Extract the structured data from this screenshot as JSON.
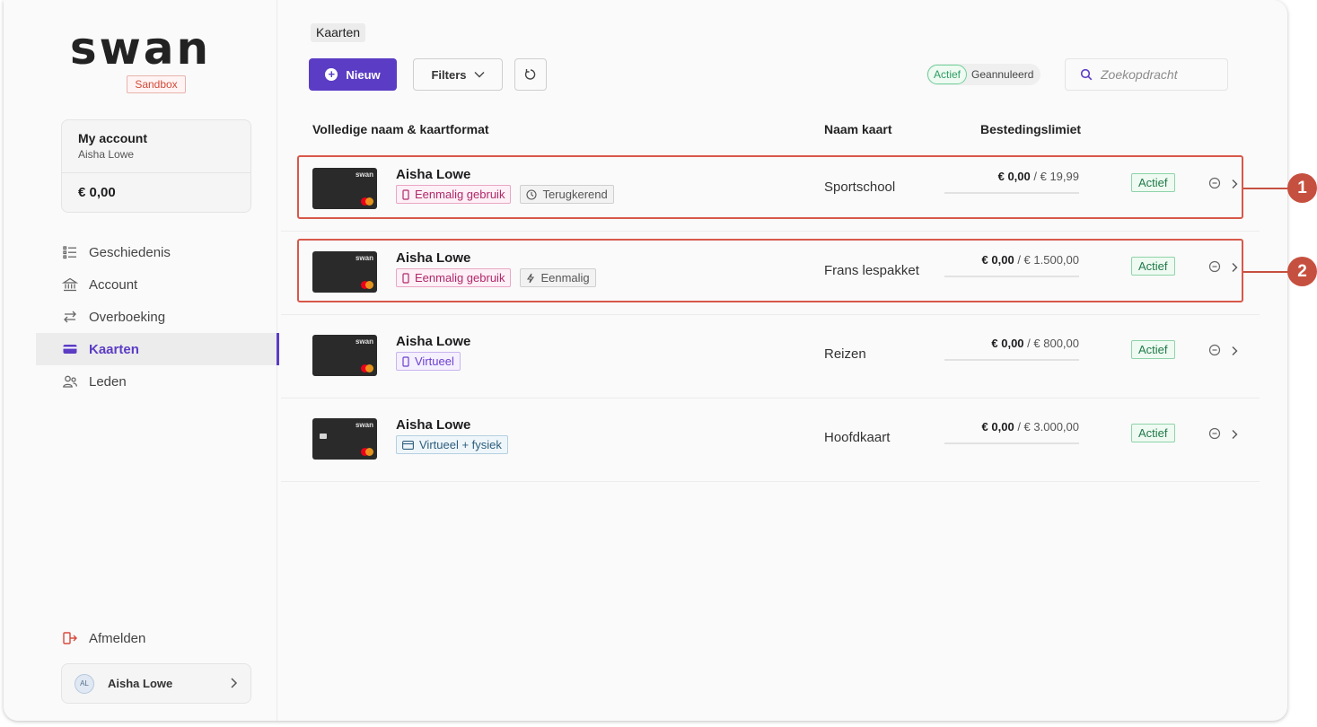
{
  "brand": {
    "logo": "swan",
    "env": "Sandbox"
  },
  "account": {
    "title": "My account",
    "holder": "Aisha Lowe",
    "balance": "€ 0,00"
  },
  "nav": [
    {
      "label": "Geschiedenis",
      "icon": "list-icon"
    },
    {
      "label": "Account",
      "icon": "bank-icon"
    },
    {
      "label": "Overboeking",
      "icon": "transfer-icon"
    },
    {
      "label": "Kaarten",
      "icon": "card-icon",
      "active": true
    },
    {
      "label": "Leden",
      "icon": "members-icon"
    }
  ],
  "logout": "Afmelden",
  "user": {
    "initials": "AL",
    "name": "Aisha Lowe"
  },
  "breadcrumb": "Kaarten",
  "toolbar": {
    "new_label": "Nieuw",
    "filters_label": "Filters"
  },
  "status_filter": {
    "active": "Actief",
    "cancelled": "Geannuleerd"
  },
  "search": {
    "placeholder": "Zoekopdracht"
  },
  "columns": {
    "name_format": "Volledige naam & kaartformat",
    "card_name": "Naam kaart",
    "limit": "Bestedingslimiet"
  },
  "rows": [
    {
      "holder": "Aisha Lowe",
      "tags": [
        {
          "label": "Eenmalig gebruik",
          "style": "pink",
          "icon": "phone-icon"
        },
        {
          "label": "Terugkerend",
          "style": "gray",
          "icon": "clock-icon"
        }
      ],
      "card_name": "Sportschool",
      "spent": "€ 0,00",
      "limit": "/ € 19,99",
      "status": "Actief"
    },
    {
      "holder": "Aisha Lowe",
      "tags": [
        {
          "label": "Eenmalig gebruik",
          "style": "pink",
          "icon": "phone-icon"
        },
        {
          "label": "Eenmalig",
          "style": "gray",
          "icon": "bolt-icon"
        }
      ],
      "card_name": "Frans lespakket",
      "spent": "€ 0,00",
      "limit": "/ € 1.500,00",
      "status": "Actief"
    },
    {
      "holder": "Aisha Lowe",
      "tags": [
        {
          "label": "Virtueel",
          "style": "purple",
          "icon": "phone-icon"
        }
      ],
      "card_name": "Reizen",
      "spent": "€ 0,00",
      "limit": "/ € 800,00",
      "status": "Actief"
    },
    {
      "holder": "Aisha Lowe",
      "tags": [
        {
          "label": "Virtueel + fysiek",
          "style": "blue",
          "icon": "card-icon"
        }
      ],
      "card_name": "Hoofdkaart",
      "spent": "€ 0,00",
      "limit": "/ € 3.000,00",
      "status": "Actief"
    }
  ],
  "card_brand": "swan",
  "callouts": [
    "1",
    "2"
  ],
  "colors": {
    "accent": "#5b3cc4",
    "callout": "#c6503f",
    "status_green": "#217a49"
  }
}
